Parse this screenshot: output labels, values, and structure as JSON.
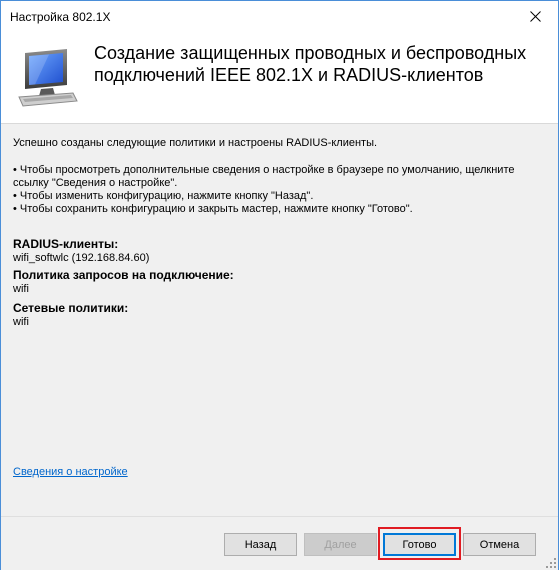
{
  "window": {
    "title": "Настройка 802.1X",
    "header_title": "Создание защищенных проводных и беспроводных\nподключений IEEE 802.1X и RADIUS-клиентов"
  },
  "content": {
    "intro": "Успешно созданы следующие политики и настроены RADIUS-клиенты.",
    "bullets": [
      "• Чтобы просмотреть дополнительные сведения о настройке в браузере по умолчанию, щелкните ссылку \"Сведения о настройке\".",
      "• Чтобы изменить конфигурацию, нажмите кнопку \"Назад\".",
      "• Чтобы сохранить конфигурацию и закрыть мастер, нажмите кнопку \"Готово\"."
    ],
    "sections": [
      {
        "label": "RADIUS-клиенты:",
        "value": "wifi_softwlc (192.168.84.60)"
      },
      {
        "label": "Политика запросов на подключение:",
        "value": "wifi"
      },
      {
        "label": "Сетевые политики:",
        "value": "wifi"
      }
    ],
    "details_link": "Сведения о настройке"
  },
  "footer": {
    "back_label": "Назад",
    "next_label": "Далее",
    "finish_label": "Готово",
    "cancel_label": "Отмена"
  },
  "colors": {
    "link": "#0066cc",
    "highlight": "#e01b22",
    "window_border": "#4a8ed8"
  },
  "icons": {
    "header": "computer-monitor-icon",
    "close": "close-icon"
  }
}
